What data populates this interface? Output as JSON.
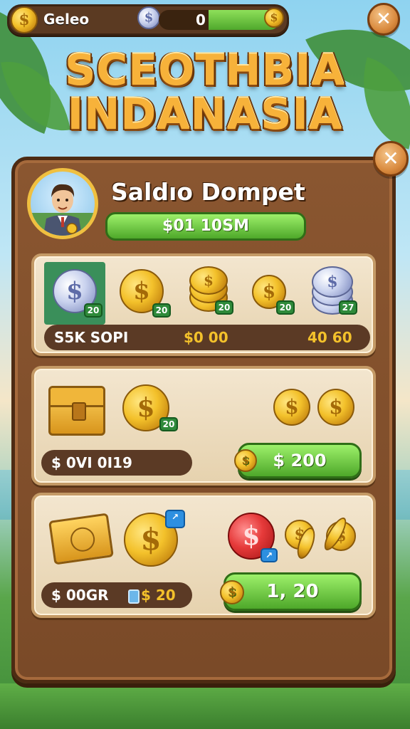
{
  "topbar": {
    "player_name": "Geleo",
    "balance_value": "0",
    "coin_symbol": "$"
  },
  "close_symbol": "✕",
  "title": {
    "line1": "SCEOTHBIA",
    "line2": "INDANASIA"
  },
  "wallet": {
    "title": "Saldıo Dompet",
    "amount": "$01 10SM"
  },
  "row1": {
    "coin_badges": [
      "20",
      "20",
      "20",
      "20",
      "27"
    ],
    "label": "S5K SOPI",
    "value1": "$0 00",
    "value2": "40 60"
  },
  "row2": {
    "coin_badge": "20",
    "label": "$ 0VI 0I19",
    "button": "$ 200"
  },
  "row3": {
    "label": "$ 00GR",
    "label_value": "$ 20",
    "button": "1, 20"
  },
  "colors": {
    "panel_wood": "#7a4a28",
    "gold": "#f3c12b",
    "green_button": "#4ea82a",
    "title_orange": "#f7b23a"
  }
}
